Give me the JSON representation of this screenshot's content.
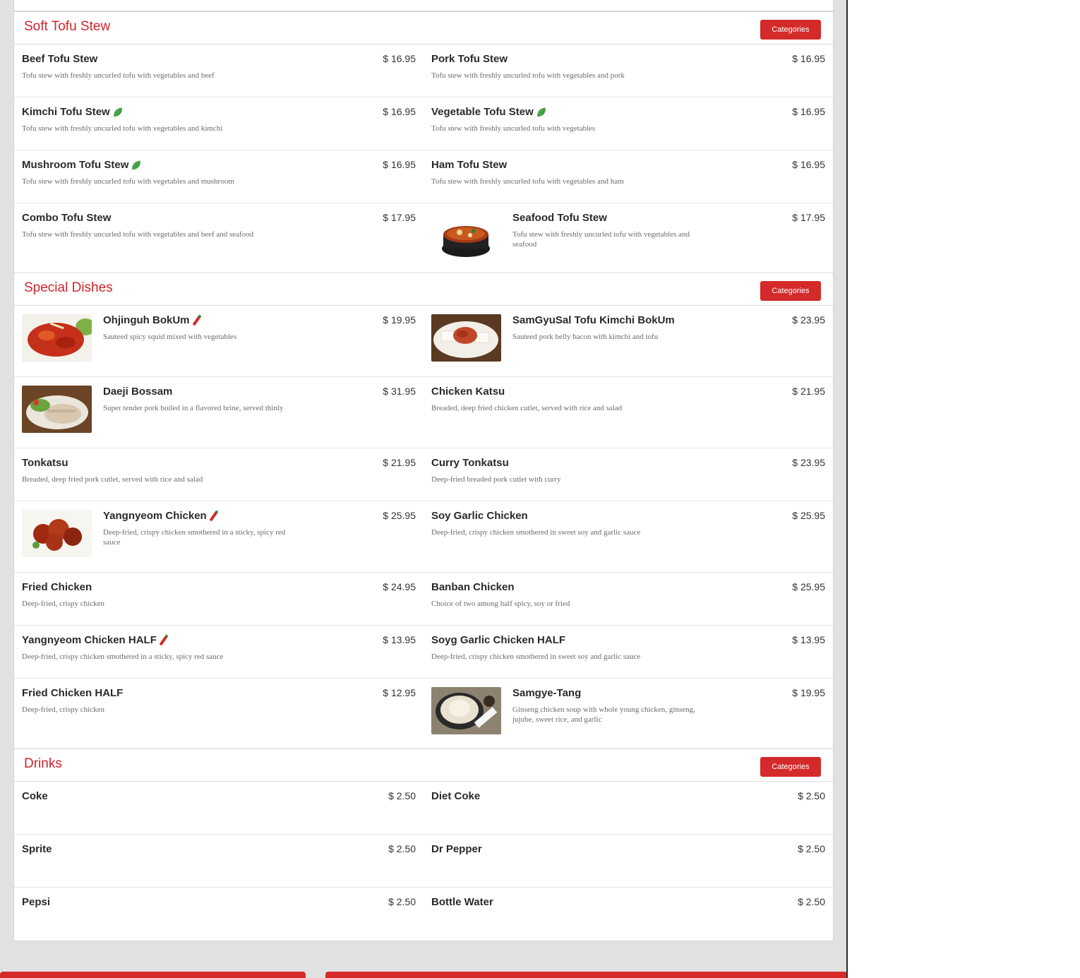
{
  "colors": {
    "accent": "#d42a2a",
    "title": "#d0252b"
  },
  "sections": [
    {
      "title": "Soft Tofu Stew",
      "button": "Categories",
      "rows": [
        [
          {
            "name": "Beef Tofu Stew",
            "price": "$ 16.95",
            "desc": "Tofu stew with freshly uncurled tofu with vegetables and beef"
          },
          {
            "name": "Pork Tofu Stew",
            "price": "$ 16.95",
            "desc": "Tofu stew with freshly uncurled tofu with vegetables and pork"
          }
        ],
        [
          {
            "name": "Kimchi Tofu Stew",
            "price": "$ 16.95",
            "desc": "Tofu stew with freshly uncurled tofu with vegetables and kimchi",
            "icon": "vegetarian-leaf-icon"
          },
          {
            "name": "Vegetable Tofu Stew",
            "price": "$ 16.95",
            "desc": "Tofu stew with freshly uncurled tofu with vegetables",
            "icon": "vegetarian-leaf-icon"
          }
        ],
        [
          {
            "name": "Mushroom Tofu Stew",
            "price": "$ 16.95",
            "desc": "Tofu stew with freshly uncurled tofu with vegetables and mushroom",
            "icon": "vegetarian-leaf-icon"
          },
          {
            "name": "Ham Tofu Stew",
            "price": "$ 16.95",
            "desc": "Tofu stew with freshly uncurled tofu with vegetables and ham"
          }
        ],
        [
          {
            "name": "Combo Tofu Stew",
            "price": "$ 17.95",
            "desc": "Tofu stew with freshly uncurled tofu with vegetables and beef and seafood"
          },
          {
            "name": "Seafood Tofu Stew",
            "price": "$ 17.95",
            "desc": "Tofu stew with freshly uncurled tofu with vegetables and seafood",
            "image": "stew-bowl-photo"
          }
        ]
      ]
    },
    {
      "title": "Special Dishes",
      "button": "Categories",
      "rows": [
        [
          {
            "name": "Ohjinguh BokUm",
            "price": "$ 19.95",
            "desc": "Sauteed spicy squid mixed with vegetables",
            "icon": "spicy-chili-icon",
            "image": "squid-dish-photo"
          },
          {
            "name": "SamGyuSal Tofu Kimchi BokUm",
            "price": "$ 23.95",
            "desc": "Sauteed pork belly bacon with kimchi and tofu",
            "image": "pork-kimchi-photo"
          }
        ],
        [
          {
            "name": "Daeji Bossam",
            "price": "$ 31.95",
            "desc": "Super tender pork boiled in a flavored brine, served thinly",
            "image": "bossam-photo"
          },
          {
            "name": "Chicken Katsu",
            "price": "$ 21.95",
            "desc": "Breaded, deep fried chicken cutlet, served with rice and salad"
          }
        ],
        [
          {
            "name": "Tonkatsu",
            "price": "$ 21.95",
            "desc": "Breaded, deep fried pork cutlet, served with rice and salad"
          },
          {
            "name": "Curry Tonkatsu",
            "price": "$ 23.95",
            "desc": "Deep-fried breaded pork cutlet with curry"
          }
        ],
        [
          {
            "name": "Yangnyeom Chicken",
            "price": "$ 25.95",
            "desc": "Deep-fried, crispy chicken smothered in a sticky, spicy red sauce",
            "icon": "spicy-chili-icon",
            "image": "yangnyeom-photo"
          },
          {
            "name": "Soy Garlic Chicken",
            "price": "$ 25.95",
            "desc": "Deep-fried, crispy chicken smothered in sweet soy and garlic sauce"
          }
        ],
        [
          {
            "name": "Fried Chicken",
            "price": "$ 24.95",
            "desc": "Deep-fried, crispy chicken"
          },
          {
            "name": "Banban Chicken",
            "price": "$ 25.95",
            "desc": "Choice of two among half spicy, soy or fried"
          }
        ],
        [
          {
            "name": "Yangnyeom Chicken HALF",
            "price": "$ 13.95",
            "desc": "Deep-fried, crispy chicken smothered in a sticky, spicy red sauce",
            "icon": "spicy-chili-icon"
          },
          {
            "name": "Soyg Garlic Chicken HALF",
            "price": "$ 13.95",
            "desc": "Deep-fried, crispy chicken smothered in sweet soy and garlic sauce"
          }
        ],
        [
          {
            "name": "Fried Chicken HALF",
            "price": "$ 12.95",
            "desc": "Deep-fried, crispy chicken"
          },
          {
            "name": "Samgye-Tang",
            "price": "$ 19.95",
            "desc": "Ginseng chicken soup with whole young chicken, ginseng, jujube, sweet rice, and garlic",
            "image": "samgyetang-photo"
          }
        ]
      ]
    },
    {
      "title": "Drinks",
      "button": "Categories",
      "rows": [
        [
          {
            "name": "Coke",
            "price": "$ 2.50",
            "desc": ""
          },
          {
            "name": "Diet Coke",
            "price": "$ 2.50",
            "desc": ""
          }
        ],
        [
          {
            "name": "Sprite",
            "price": "$ 2.50",
            "desc": ""
          },
          {
            "name": "Dr Pepper",
            "price": "$ 2.50",
            "desc": ""
          }
        ],
        [
          {
            "name": "Pepsi",
            "price": "$ 2.50",
            "desc": ""
          },
          {
            "name": "Bottle Water",
            "price": "$ 2.50",
            "desc": ""
          }
        ]
      ]
    }
  ]
}
